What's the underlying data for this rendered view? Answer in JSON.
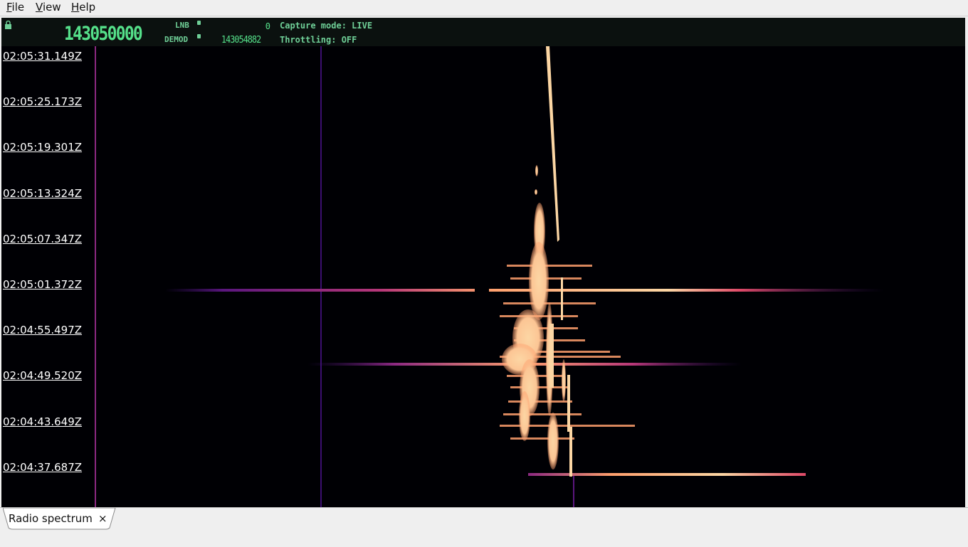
{
  "menubar": {
    "items": [
      {
        "label": "File",
        "accel": "F",
        "rest": "ile"
      },
      {
        "label": "View",
        "accel": "V",
        "rest": "iew"
      },
      {
        "label": "Help",
        "accel": "H",
        "rest": "elp"
      }
    ]
  },
  "status": {
    "main_frequency": "143050000",
    "lnb_label": "LNB",
    "lnb_value": "0",
    "demod_label": "DEMOD",
    "demod_value": "143054882",
    "capture_mode": "Capture mode: LIVE",
    "throttling": "Throttling: OFF"
  },
  "waterfall": {
    "timestamps": [
      "02:05:31.149Z",
      "02:05:25.173Z",
      "02:05:19.301Z",
      "02:05:13.324Z",
      "02:05:07.347Z",
      "02:05:01.372Z",
      "02:04:55.497Z",
      "02:04:49.520Z",
      "02:04:43.649Z",
      "02:04:37.687Z"
    ],
    "colormap": [
      "#000004",
      "#3b0f70",
      "#8c2981",
      "#de4968",
      "#fe9f6d",
      "#fcd6a4"
    ]
  },
  "tabs": [
    {
      "label": "Radio spectrum",
      "close_glyph": "×"
    }
  ]
}
